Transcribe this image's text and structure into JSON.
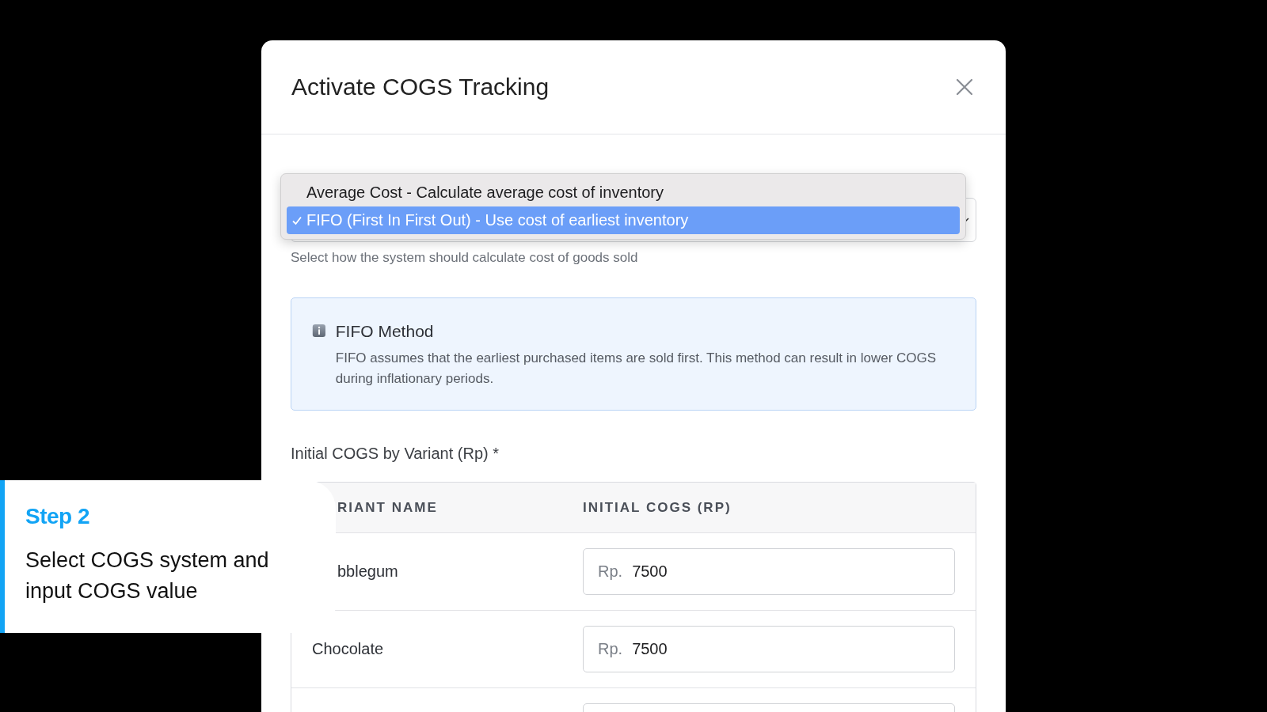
{
  "modal": {
    "title": "Activate COGS Tracking"
  },
  "cogs_system": {
    "helper": "Select how the system should calculate cost of goods sold",
    "options": [
      {
        "label": "Average Cost - Calculate average cost of inventory",
        "selected": false
      },
      {
        "label": "FIFO (First In First Out) - Use cost of earliest inventory",
        "selected": true
      }
    ]
  },
  "info": {
    "title": "FIFO Method",
    "text": "FIFO assumes that the earliest purchased items are sold first. This method can result in lower COGS during inflationary periods."
  },
  "variants": {
    "label": "Initial COGS by Variant (Rp) *",
    "columns": [
      {
        "label": "RIANT NAME",
        "covered": true
      },
      {
        "label": "INITIAL COGS (RP)",
        "covered": false
      }
    ],
    "rows": [
      {
        "name": "bblegum",
        "covered": true,
        "prefix": "Rp.",
        "value": "7500"
      },
      {
        "name": "Chocolate",
        "covered": false,
        "prefix": "Rp.",
        "value": "7500"
      }
    ]
  },
  "step": {
    "title": "Step 2",
    "text": "Select COGS system and input COGS value"
  }
}
